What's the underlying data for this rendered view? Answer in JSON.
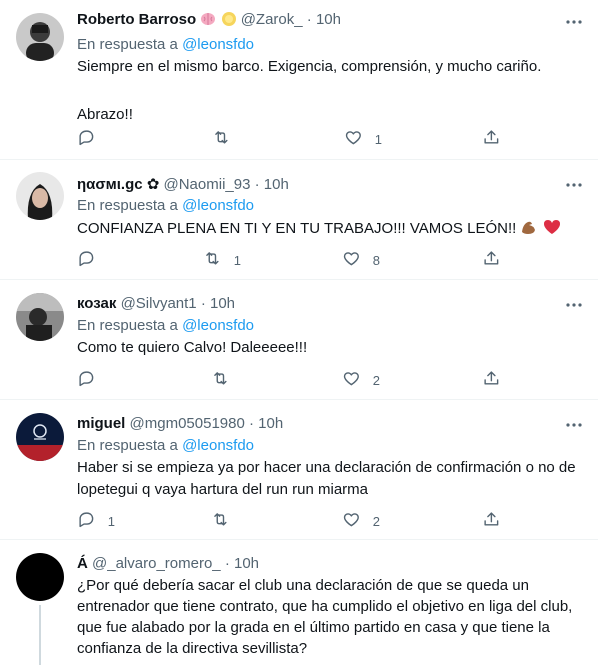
{
  "tweets": [
    {
      "name": "Roberto Barroso",
      "handle": "@Zarok_",
      "separator": "·",
      "time": "10h",
      "reply_prefix": "En respuesta a ",
      "reply_to": "@leonsfdo",
      "lines": [
        "Siempre en el mismo barco. Exigencia, comprensión, y mucho cariño.",
        "",
        "Abrazo!!"
      ],
      "emojis": [
        "brain-emoji",
        "sun-emoji"
      ],
      "replies": "",
      "retweets": "",
      "likes": "1"
    },
    {
      "name": "ηασмι.gc ✿",
      "handle": "@Naomii_93",
      "separator": "·",
      "time": "10h",
      "reply_prefix": "En respuesta a ",
      "reply_to": "@leonsfdo",
      "lines": [
        "CONFIANZA PLENA EN TI Y EN TU TRABAJO!!! VAMOS LEÓN!!"
      ],
      "emojis": [
        "flexed-biceps-emoji",
        "red-heart-emoji"
      ],
      "replies": "",
      "retweets": "1",
      "likes": "8"
    },
    {
      "name": "козак",
      "handle": "@Silvyant1",
      "separator": "·",
      "time": "10h",
      "reply_prefix": "En respuesta a ",
      "reply_to": "@leonsfdo",
      "lines": [
        "Como te quiero Calvo! Daleeeee!!!"
      ],
      "replies": "",
      "retweets": "",
      "likes": "2"
    },
    {
      "name": "miguel",
      "handle": "@mgm05051980",
      "separator": "·",
      "time": "10h",
      "reply_prefix": "En respuesta a ",
      "reply_to": "@leonsfdo",
      "lines": [
        "Haber si se empieza ya por hacer una declaración de confirmación o no de",
        "lopetegui q vaya hartura del run run miarma"
      ],
      "replies": "1",
      "retweets": "",
      "likes": "2"
    },
    {
      "name": "Á",
      "handle": "@_alvaro_romero_",
      "separator": "·",
      "time": "10h",
      "lines": [
        "¿Por qué debería sacar el club una declaración de que se queda un",
        "entrenador que tiene contrato, que ha cumplido el objetivo en liga del club,",
        "que fue alabado por la grada en el último partido en casa y que tiene la",
        "confianza de la directiva sevillista?"
      ]
    }
  ],
  "icons": {
    "more": "more-horizontal-icon",
    "reply": "reply-icon",
    "retweet": "retweet-icon",
    "like": "heart-icon",
    "share": "share-icon"
  },
  "colors": {
    "text": "#0f1419",
    "secondary": "#536471",
    "link": "#1d9bf0",
    "divider": "#eff3f4"
  }
}
